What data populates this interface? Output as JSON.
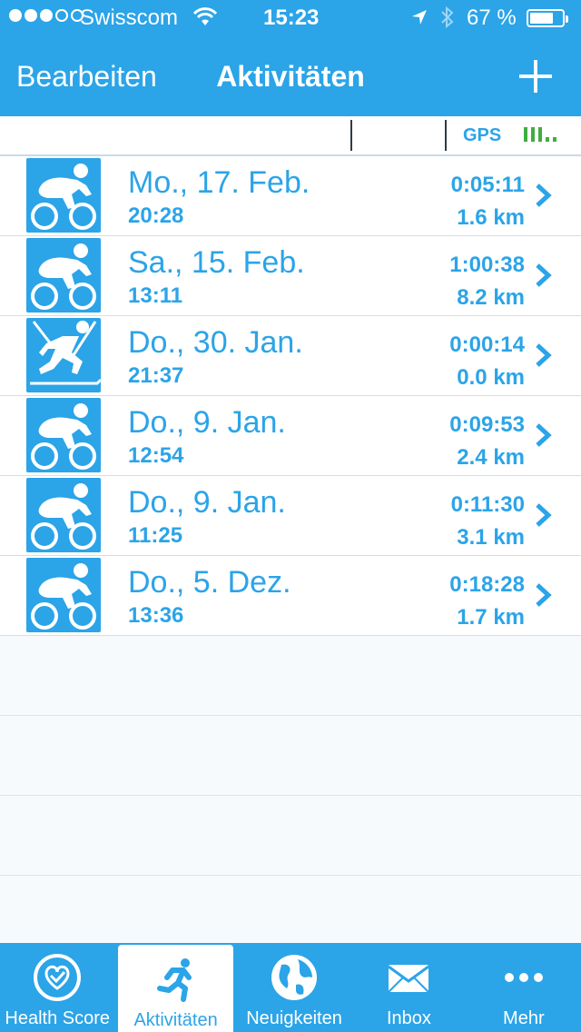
{
  "status_bar": {
    "carrier": "Swisscom",
    "time": "15:23",
    "battery_percent": "67 %",
    "battery_level": 0.67,
    "signal_bars_filled": 3,
    "signal_bars_total": 5
  },
  "nav": {
    "edit_label": "Bearbeiten",
    "title": "Aktivitäten",
    "add_icon": "plus-icon"
  },
  "subbar": {
    "gps_label": "GPS"
  },
  "activities": [
    {
      "type": "cycling",
      "date": "Mo., 17. Feb.",
      "time": "20:28",
      "duration": "0:05:11",
      "distance": "1.6 km"
    },
    {
      "type": "cycling",
      "date": "Sa., 15. Feb.",
      "time": "13:11",
      "duration": "1:00:38",
      "distance": "8.2 km"
    },
    {
      "type": "cross-country-skiing",
      "date": "Do., 30. Jan.",
      "time": "21:37",
      "duration": "0:00:14",
      "distance": "0.0 km"
    },
    {
      "type": "cycling",
      "date": "Do., 9. Jan.",
      "time": "12:54",
      "duration": "0:09:53",
      "distance": "2.4 km"
    },
    {
      "type": "cycling",
      "date": "Do., 9. Jan.",
      "time": "11:25",
      "duration": "0:11:30",
      "distance": "3.1 km"
    },
    {
      "type": "cycling",
      "date": "Do., 5. Dez.",
      "time": "13:36",
      "duration": "0:18:28",
      "distance": "1.7 km"
    }
  ],
  "tabs": [
    {
      "label": "Health Score",
      "icon": "health-score-icon",
      "active": false
    },
    {
      "label": "Aktivitäten",
      "icon": "runner-icon",
      "active": true
    },
    {
      "label": "Neuigkeiten",
      "icon": "globe-icon",
      "active": false
    },
    {
      "label": "Inbox",
      "icon": "envelope-icon",
      "active": false
    },
    {
      "label": "Mehr",
      "icon": "more-dots-icon",
      "active": false
    }
  ],
  "colors": {
    "accent": "#2ba4e8",
    "gps_signal": "#3fae3f"
  }
}
